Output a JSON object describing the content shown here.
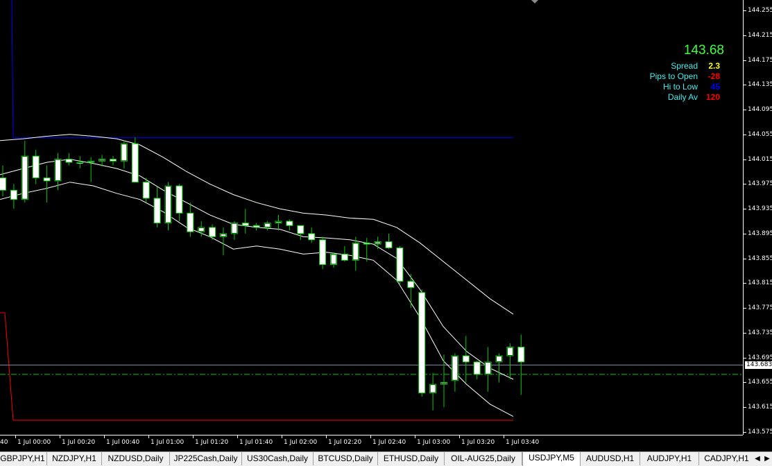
{
  "chart": {
    "symbol": "USDJPY",
    "timeframe": "M5",
    "colors": {
      "background": "#000000",
      "candle_bull": "#ffffff",
      "candle_bear": "#ffffff",
      "wick": "#00cc00",
      "envelope": "#ffffff",
      "high_line": "#0000ff",
      "low_line": "#ff0000",
      "bid_line": "#7f8fa6",
      "open_line": "#00cc00"
    },
    "price_axis": {
      "min": 143.575,
      "max": 144.255,
      "labels": [
        "144.255",
        "144.215",
        "144.175",
        "144.135",
        "144.095",
        "144.055",
        "144.015",
        "143.975",
        "143.935",
        "143.895",
        "143.855",
        "143.815",
        "143.775",
        "143.735",
        "143.695",
        "143.655",
        "143.615",
        "143.575"
      ]
    },
    "current_price": "143.683",
    "time_axis": {
      "labels": [
        "40",
        "1 Jul 00:00",
        "1 Jul 00:20",
        "1 Jul 00:40",
        "1 Jul 01:00",
        "1 Jul 01:20",
        "1 Jul 01:40",
        "1 Jul 02:00",
        "1 Jul 02:20",
        "1 Jul 02:40",
        "1 Jul 03:00",
        "1 Jul 03:20",
        "1 Jul 03:40"
      ]
    },
    "candles": [
      {
        "o": 143.985,
        "h": 144.005,
        "l": 143.955,
        "c": 143.965
      },
      {
        "o": 143.965,
        "h": 143.975,
        "l": 143.935,
        "c": 143.95
      },
      {
        "o": 143.95,
        "h": 144.045,
        "l": 143.945,
        "c": 144.02
      },
      {
        "o": 144.02,
        "h": 144.03,
        "l": 143.975,
        "c": 143.985
      },
      {
        "o": 143.985,
        "h": 144.005,
        "l": 143.945,
        "c": 143.98
      },
      {
        "o": 143.98,
        "h": 144.025,
        "l": 143.965,
        "c": 144.015
      },
      {
        "o": 144.015,
        "h": 144.025,
        "l": 144.005,
        "c": 144.01
      },
      {
        "o": 144.01,
        "h": 144.02,
        "l": 144.0,
        "c": 144.01
      },
      {
        "o": 144.01,
        "h": 144.018,
        "l": 143.978,
        "c": 144.012
      },
      {
        "o": 144.012,
        "h": 144.022,
        "l": 144.003,
        "c": 144.015
      },
      {
        "o": 144.015,
        "h": 144.02,
        "l": 144.005,
        "c": 144.012
      },
      {
        "o": 144.012,
        "h": 144.045,
        "l": 144.0,
        "c": 144.04
      },
      {
        "o": 144.04,
        "h": 144.05,
        "l": 143.978,
        "c": 143.978
      },
      {
        "o": 143.978,
        "h": 143.985,
        "l": 143.945,
        "c": 143.952
      },
      {
        "o": 143.952,
        "h": 143.97,
        "l": 143.905,
        "c": 143.912
      },
      {
        "o": 143.912,
        "h": 143.978,
        "l": 143.9,
        "c": 143.972
      },
      {
        "o": 143.972,
        "h": 143.975,
        "l": 143.915,
        "c": 143.928
      },
      {
        "o": 143.928,
        "h": 143.945,
        "l": 143.89,
        "c": 143.898
      },
      {
        "o": 143.898,
        "h": 143.915,
        "l": 143.89,
        "c": 143.905
      },
      {
        "o": 143.905,
        "h": 143.91,
        "l": 143.885,
        "c": 143.89
      },
      {
        "o": 143.89,
        "h": 143.905,
        "l": 143.86,
        "c": 143.895
      },
      {
        "o": 143.895,
        "h": 143.915,
        "l": 143.885,
        "c": 143.912
      },
      {
        "o": 143.912,
        "h": 143.935,
        "l": 143.895,
        "c": 143.908
      },
      {
        "o": 143.908,
        "h": 143.912,
        "l": 143.9,
        "c": 143.905
      },
      {
        "o": 143.905,
        "h": 143.915,
        "l": 143.9,
        "c": 143.912
      },
      {
        "o": 143.912,
        "h": 143.925,
        "l": 143.9,
        "c": 143.915
      },
      {
        "o": 143.915,
        "h": 143.918,
        "l": 143.9,
        "c": 143.908
      },
      {
        "o": 143.908,
        "h": 143.905,
        "l": 143.885,
        "c": 143.895
      },
      {
        "o": 143.895,
        "h": 143.905,
        "l": 143.88,
        "c": 143.885
      },
      {
        "o": 143.885,
        "h": 143.89,
        "l": 143.838,
        "c": 143.845
      },
      {
        "o": 143.845,
        "h": 143.865,
        "l": 143.84,
        "c": 143.862
      },
      {
        "o": 143.862,
        "h": 143.875,
        "l": 143.85,
        "c": 143.852
      },
      {
        "o": 143.852,
        "h": 143.89,
        "l": 143.835,
        "c": 143.88
      },
      {
        "o": 143.88,
        "h": 143.888,
        "l": 143.85,
        "c": 143.878
      },
      {
        "o": 143.878,
        "h": 143.89,
        "l": 143.87,
        "c": 143.882
      },
      {
        "o": 143.882,
        "h": 143.895,
        "l": 143.87,
        "c": 143.872
      },
      {
        "o": 143.872,
        "h": 143.875,
        "l": 143.812,
        "c": 143.818
      },
      {
        "o": 143.818,
        "h": 143.83,
        "l": 143.775,
        "c": 143.808
      },
      {
        "o": 143.8,
        "h": 143.805,
        "l": 143.632,
        "c": 143.638
      },
      {
        "o": 143.638,
        "h": 143.67,
        "l": 143.61,
        "c": 143.652
      },
      {
        "o": 143.652,
        "h": 143.7,
        "l": 143.615,
        "c": 143.655
      },
      {
        "o": 143.658,
        "h": 143.702,
        "l": 143.64,
        "c": 143.698
      },
      {
        "o": 143.698,
        "h": 143.73,
        "l": 143.655,
        "c": 143.688
      },
      {
        "o": 143.688,
        "h": 143.69,
        "l": 143.66,
        "c": 143.668
      },
      {
        "o": 143.668,
        "h": 143.712,
        "l": 143.64,
        "c": 143.688
      },
      {
        "o": 143.688,
        "h": 143.702,
        "l": 143.655,
        "c": 143.698
      },
      {
        "o": 143.698,
        "h": 143.718,
        "l": 143.66,
        "c": 143.712
      },
      {
        "o": 143.712,
        "h": 143.732,
        "l": 143.635,
        "c": 143.688
      }
    ],
    "envelope_upper": [
      144.045,
      144.048,
      144.052,
      144.055,
      144.052,
      144.048,
      144.038,
      144.018,
      143.995,
      143.975,
      143.958,
      143.945,
      143.935,
      143.928,
      143.925,
      143.92,
      143.918,
      143.905,
      143.88,
      143.85,
      143.82,
      143.79,
      143.765
    ],
    "envelope_lower": [
      143.95,
      143.96,
      143.968,
      143.978,
      143.972,
      143.96,
      143.95,
      143.93,
      143.905,
      143.89,
      143.87,
      143.875,
      143.87,
      143.862,
      143.865,
      143.86,
      143.852,
      143.82,
      143.76,
      143.69,
      143.652,
      143.62,
      143.6
    ],
    "envelope_mid": [
      143.99,
      144.0,
      144.01,
      144.015,
      144.008,
      144.0,
      143.988,
      143.965,
      143.945,
      143.925,
      143.91,
      143.905,
      143.902,
      143.89,
      143.888,
      143.885,
      143.878,
      143.855,
      143.805,
      143.745,
      143.705,
      143.678,
      143.66
    ],
    "high_line_price": 144.05,
    "low_line_price": 143.594,
    "open_line_price": 143.668,
    "bid_line_price": 143.683
  },
  "info_panel": {
    "price": "143.68",
    "rows": [
      {
        "label": "Spread",
        "value": "2.3",
        "color": "#ffff00"
      },
      {
        "label": "Pips to Open",
        "value": "-28",
        "color": "#ff0000"
      },
      {
        "label": "Hi to Low",
        "value": "45",
        "color": "#0000ff"
      },
      {
        "label": "Daily Av",
        "value": "120",
        "color": "#ff0000"
      }
    ]
  },
  "tabs": [
    {
      "label": "GBPJPY,H1",
      "active": false
    },
    {
      "label": "NZDJPY,H1",
      "active": false
    },
    {
      "label": "NZDUSD,Daily",
      "active": false
    },
    {
      "label": "JP225Cash,Daily",
      "active": false
    },
    {
      "label": "US30Cash,Daily",
      "active": false
    },
    {
      "label": "BTCUSD,Daily",
      "active": false
    },
    {
      "label": "ETHUSD,Daily",
      "active": false
    },
    {
      "label": "OIL-AUG25,Daily",
      "active": false
    },
    {
      "label": "USDJPY,M5",
      "active": true
    },
    {
      "label": "AUDUSD,H1",
      "active": false
    },
    {
      "label": "AUDJPY,H1",
      "active": false
    },
    {
      "label": "CADJPY,H1",
      "active": false
    }
  ],
  "tab_scroll": {
    "left": "◀",
    "right": "▶"
  }
}
